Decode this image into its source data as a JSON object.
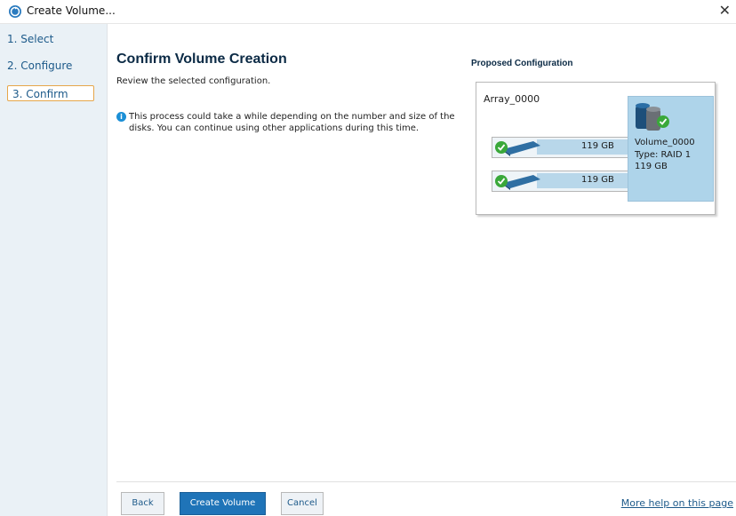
{
  "window": {
    "title": "Create Volume...",
    "app_icon": "refresh-icon",
    "close_icon": "close-icon"
  },
  "sidebar": {
    "items": [
      {
        "label": "1. Select"
      },
      {
        "label": "2. Configure"
      },
      {
        "label": "3. Confirm"
      }
    ]
  },
  "main": {
    "heading": "Confirm Volume Creation",
    "subtext": "Review the selected configuration.",
    "info": "This process could take a while depending on the number and size of the disks. You can continue using other applications during this time."
  },
  "config": {
    "title": "Proposed Configuration",
    "array_label": "Array_0000",
    "disks": [
      {
        "size": "119 GB"
      },
      {
        "size": "119 GB"
      }
    ],
    "volume": {
      "name": "Volume_0000",
      "type": "Type: RAID 1",
      "size": "119 GB"
    }
  },
  "footer": {
    "back_label": "Back",
    "create_label": "Create Volume",
    "cancel_label": "Cancel",
    "help_link": "More help on this page"
  },
  "colors": {
    "accent": "#1f74b8",
    "active_step_border": "#e6a64a",
    "disk_bar": "#b8d7ea",
    "volume_card": "#aed4ea"
  }
}
